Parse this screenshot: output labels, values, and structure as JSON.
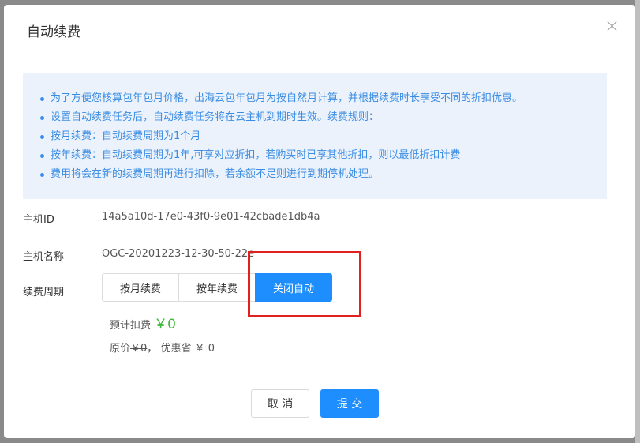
{
  "modal": {
    "title": "自动续费"
  },
  "notice": {
    "items": [
      "为了方便您核算包年包月价格，出海云包年包月为按自然月计算，并根据续费时长享受不同的折扣优惠。",
      "设置自动续费任务后，自动续费任务将在云主机到期时生效。续费规则：",
      "按月续费：自动续费周期为1个月",
      "按年续费：自动续费周期为1年,可享对应折扣，若购买时已享其他折扣，则以最低折扣计费",
      "费用将会在新的续费周期再进行扣除，若余额不足则进行到期停机处理。"
    ]
  },
  "host": {
    "id_label": "主机ID",
    "id_value": "14a5a10d-17e0-43f0-9e01-42cbade1db4a",
    "name_label": "主机名称",
    "name_value": "OGC-20201223-12-30-50-22e",
    "period_label": "续费周期"
  },
  "period_options": {
    "monthly": "按月续费",
    "yearly": "按年续费",
    "off": "关闭自动",
    "selected": "关闭自动"
  },
  "price": {
    "estimate_label": "预计扣费",
    "estimate_value": "￥0",
    "original_label": "原价",
    "original_value": "￥0",
    "separator": "，",
    "discount_label": "优惠省",
    "discount_value": "￥ 0"
  },
  "footer": {
    "cancel": "取 消",
    "submit": "提 交"
  },
  "colors": {
    "primary": "#1e8eff",
    "notice_text": "#3b8de3",
    "notice_bg": "#ecf2fb",
    "price_green": "#3fb837",
    "highlight_red": "#e32020"
  }
}
